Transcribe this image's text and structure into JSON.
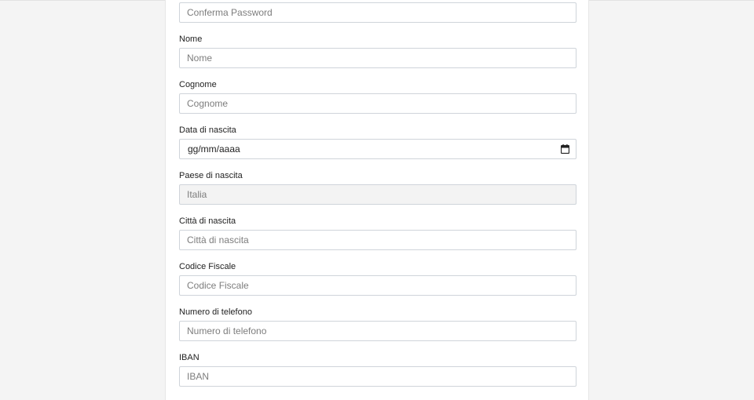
{
  "form": {
    "confirm_password": {
      "placeholder": "Conferma Password"
    },
    "first_name": {
      "label": "Nome",
      "placeholder": "Nome"
    },
    "last_name": {
      "label": "Cognome",
      "placeholder": "Cognome"
    },
    "birth_date": {
      "label": "Data di nascita",
      "value": "gg/mm/aaaa",
      "icon": "calendar-icon"
    },
    "birth_country": {
      "label": "Paese di nascita",
      "value": "Italia"
    },
    "birth_city": {
      "label": "Città di nascita",
      "placeholder": "Città di nascita"
    },
    "tax_code": {
      "label": "Codice Fiscale",
      "placeholder": "Codice Fiscale"
    },
    "phone": {
      "label": "Numero di telefono",
      "placeholder": "Numero di telefono"
    },
    "iban": {
      "label": "IBAN",
      "placeholder": "IBAN"
    }
  },
  "colors": {
    "page_background": "#f4f4f4",
    "card_background": "#ffffff",
    "input_border": "#cfd4da",
    "readonly_background": "#f3f3f3"
  }
}
